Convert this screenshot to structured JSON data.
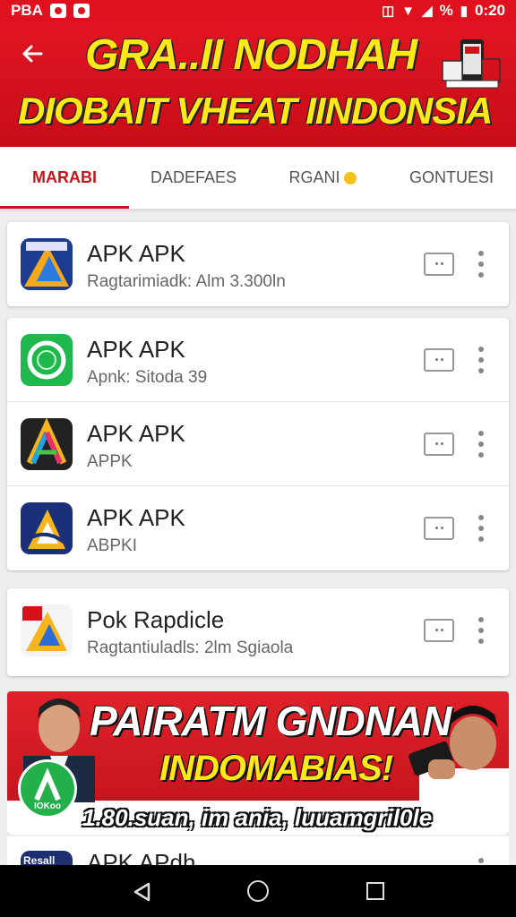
{
  "status_bar": {
    "left_text": "PBA",
    "battery_text": "%",
    "time": "0:20"
  },
  "header": {
    "back_icon": "arrow-left-icon",
    "banner_line1": "GRA..II NODHAH",
    "banner_line2": "DIOBAIT VHEAT IINDONSIA"
  },
  "tabs": [
    {
      "label": "MARABI",
      "active": true
    },
    {
      "label": "DADEFAES",
      "active": false
    },
    {
      "label": "RGANI",
      "active": false
    },
    {
      "label": "GONTUESI",
      "active": false
    }
  ],
  "apps": [
    {
      "title": "APK APK",
      "subtitle": "Ragtarimiadk: Alm 3.300ln"
    },
    {
      "title": "APK APK",
      "subtitle": "Apnk: Sitoda 39"
    },
    {
      "title": "APK APK",
      "subtitle": "APPK"
    },
    {
      "title": "APK APK",
      "subtitle": "ABPKI"
    },
    {
      "title": "Pok Rapdicle",
      "subtitle": "Ragtantiuladls: 2lm Sgiaola"
    }
  ],
  "ad": {
    "line1": "PAIRATM GNDNAN",
    "line2": "INDOMABIAS!",
    "line3": "1.80.suan, im ania, luuamgril0le",
    "logo_text": "IOKoo"
  },
  "partial_row": {
    "title": "APK APdh",
    "icon_text": "Resall"
  },
  "colors": {
    "accent": "#c8141c",
    "banner_red": "#e21522",
    "banner_yellow": "#ffe81a"
  }
}
